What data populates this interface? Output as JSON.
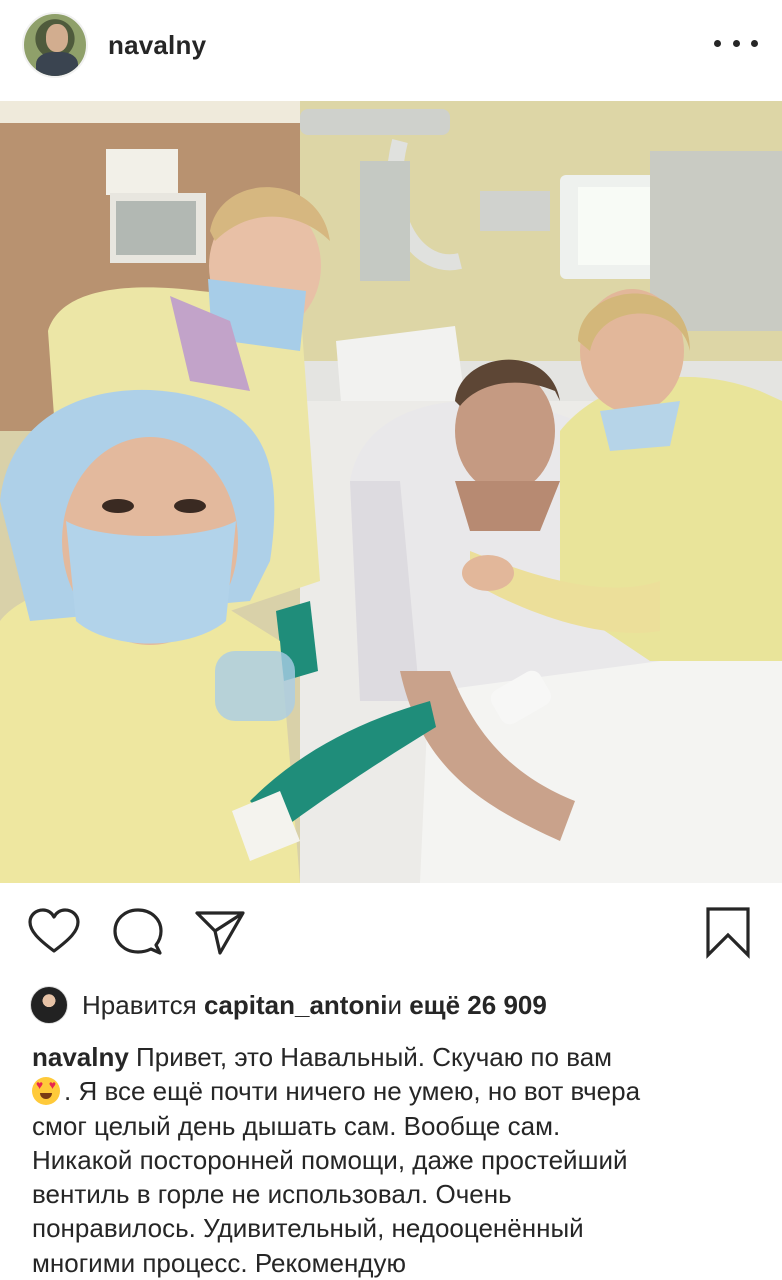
{
  "post": {
    "username": "navalny",
    "more_icon": "more-horizontal-icon",
    "photo_icon": "post-photo-hospital-selfie"
  },
  "actions": {
    "like_icon": "heart-outline-icon",
    "comment_icon": "comment-bubble-icon",
    "share_icon": "send-paper-plane-icon",
    "save_icon": "bookmark-outline-icon"
  },
  "likes": {
    "prefix": "Нравится ",
    "user": "capitan_antoni",
    "middle": " и ",
    "count": "ещё 26 909"
  },
  "caption": {
    "user": "navalny",
    "line1": " Привет, это Навальный. Скучаю по вам",
    "emoji": "heart-eyes-emoji",
    "line2": ". Я все ещё почти ничего не умею, но вот вчера",
    "line3": "смог целый день дышать сам. Вообще сам.",
    "line4": "Никакой посторонней помощи, даже простейший",
    "line5": "вентиль в горле не использовал. Очень",
    "line6": "понравилось. Удивительный, недооценённый",
    "line7": "многими процесс. Рекомендую"
  },
  "colors": {
    "text": "#262626",
    "gown": "#eee7a0",
    "mask": "#a9cde6",
    "glove": "#1d8b78"
  }
}
